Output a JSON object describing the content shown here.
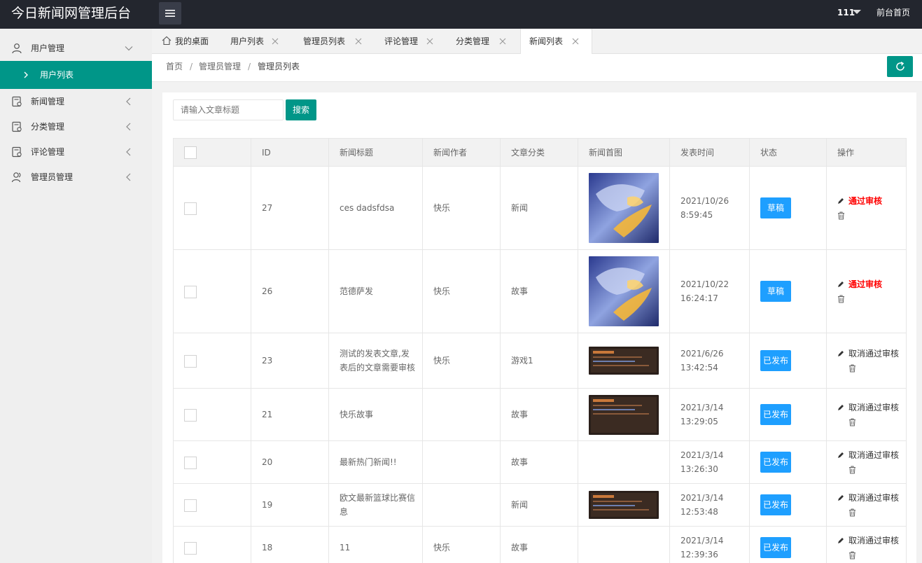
{
  "header": {
    "logo": "今日新闻网管理后台",
    "user": "111",
    "front_link": "前台首页"
  },
  "sidebar": {
    "items": [
      {
        "label": "用户管理",
        "icon": "user-icon"
      },
      {
        "label": "新闻管理",
        "icon": "document-icon"
      },
      {
        "label": "分类管理",
        "icon": "document-icon"
      },
      {
        "label": "评论管理",
        "icon": "document-icon"
      },
      {
        "label": "管理员管理",
        "icon": "users-icon"
      }
    ],
    "active_sub": "用户列表"
  },
  "tabs": [
    {
      "label": "我的桌面"
    },
    {
      "label": "用户列表"
    },
    {
      "label": "管理员列表"
    },
    {
      "label": "评论管理"
    },
    {
      "label": "分类管理"
    },
    {
      "label": "新闻列表"
    }
  ],
  "breadcrumb": [
    "首页",
    "管理员管理",
    "管理员列表"
  ],
  "search": {
    "placeholder": "请输入文章标题",
    "button": "搜索"
  },
  "table": {
    "headers": [
      "ID",
      "新闻标题",
      "新闻作者",
      "文章分类",
      "新闻首图",
      "发表时间",
      "状态",
      "操作"
    ],
    "rows": [
      {
        "id": "27",
        "title": "ces dadsfdsa",
        "author": "快乐",
        "category": "新闻",
        "image": "anime-girl",
        "time": "2021/10/26 8:59:45",
        "status": "草稿",
        "action": "通过审核"
      },
      {
        "id": "26",
        "title": "范德萨发",
        "author": "快乐",
        "category": "故事",
        "image": "anime-girl",
        "time": "2021/10/22 16:24:17",
        "status": "草稿",
        "action": "通过审核"
      },
      {
        "id": "23",
        "title": "测试的发表文章,发表后的文章需要审核",
        "author": "快乐",
        "category": "游戏1",
        "image": "dark-banner",
        "time": "2021/6/26 13:42:54",
        "status": "已发布",
        "action": "取消通过审核"
      },
      {
        "id": "21",
        "title": "快乐故事",
        "author": "",
        "category": "故事",
        "image": "dark-banner-tall",
        "time": "2021/3/14 13:29:05",
        "status": "已发布",
        "action": "取消通过审核"
      },
      {
        "id": "20",
        "title": "最新热门新闻!!",
        "author": "",
        "category": "故事",
        "image": "",
        "time": "2021/3/14 13:26:30",
        "status": "已发布",
        "action": "取消通过审核"
      },
      {
        "id": "19",
        "title": "欧文最新篮球比赛信息",
        "author": "",
        "category": "新闻",
        "image": "dark-banner",
        "time": "2021/3/14 12:53:48",
        "status": "已发布",
        "action": "取消通过审核"
      },
      {
        "id": "18",
        "title": "11",
        "author": "快乐",
        "category": "故事",
        "image": "",
        "time": "2021/3/14 12:39:36",
        "status": "已发布",
        "action": "取消通过审核"
      }
    ]
  },
  "colors": {
    "header_bg": "#23262e",
    "accent": "#009688",
    "status_blue": "#1e9fff",
    "approve_red": "#ff0000"
  }
}
